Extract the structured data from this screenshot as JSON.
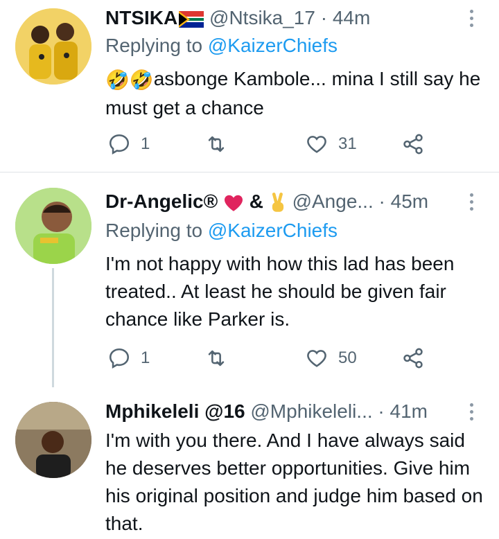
{
  "tweets": [
    {
      "name": "NTSIKA",
      "handle": "@Ntsika_17",
      "sep": "·",
      "time": "44m",
      "replying_prefix": "Replying to ",
      "replying_to": "@KaizerChiefs",
      "emoji_prefix": "🤣🤣",
      "text": "asbonge Kambole... mina I still say he must get a chance",
      "reply_count": "1",
      "retweet_count": "",
      "like_count": "31"
    },
    {
      "name": "Dr-Angelic",
      "name_suffix": "®",
      "handle": "@Ange...",
      "sep": "·",
      "time": "45m",
      "replying_prefix": "Replying to ",
      "replying_to": "@KaizerChiefs",
      "text": "I'm not happy with how this lad has been treated.. At least he should be given fair chance like Parker is.",
      "reply_count": "1",
      "retweet_count": "",
      "like_count": "50"
    },
    {
      "name": "Mphikeleli @16",
      "handle": "@Mphikeleli...",
      "sep": "·",
      "time": "41m",
      "text": "I'm with you there. And I have always said he deserves better opportunities. Give him his original position and judge him based on that."
    }
  ],
  "colors": {
    "text": "#0f1419",
    "muted": "#536471",
    "link": "#1d9bf0",
    "heart": "#e0245e",
    "divider": "#dfe3e6"
  },
  "icons": [
    "reply-icon",
    "retweet-icon",
    "like-icon",
    "share-icon",
    "more-icon"
  ]
}
